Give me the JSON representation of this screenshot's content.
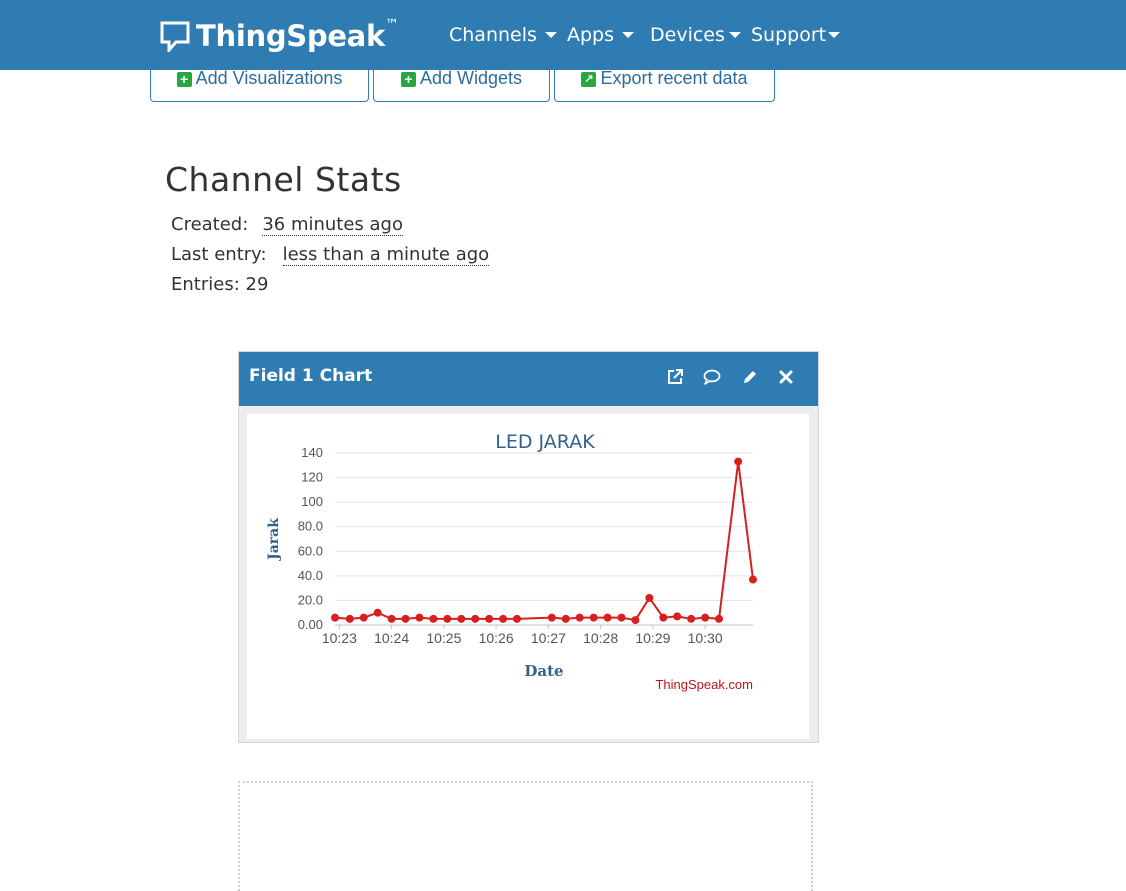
{
  "nav": {
    "brand": "ThingSpeak",
    "brand_mark": "™",
    "items": [
      {
        "label": "Channels"
      },
      {
        "label": "Apps"
      },
      {
        "label": "Devices"
      },
      {
        "label": "Support"
      }
    ]
  },
  "actions": {
    "add_visualizations": "Add Visualizations",
    "add_widgets": "Add Widgets",
    "export_recent": "Export recent data"
  },
  "stats": {
    "title": "Channel Stats",
    "created_label": "Created:",
    "created_value": "36 minutes ago",
    "last_entry_label": "Last entry:",
    "last_entry_value": "less than a minute ago",
    "entries_label": "Entries:",
    "entries_value": "29"
  },
  "widget": {
    "title": "Field 1 Chart",
    "icons": [
      "external-link-icon",
      "comment-icon",
      "pencil-icon",
      "close-icon"
    ],
    "credit": "ThingSpeak.com"
  },
  "colors": {
    "brand_blue": "#2f7cb3",
    "series_red": "#d62020",
    "axis_label_blue": "#34618a"
  },
  "chart_data": {
    "type": "line",
    "title": "LED JARAK",
    "xlabel": "Date",
    "ylabel": "Jarak",
    "ylim": [
      0,
      140
    ],
    "yticks": [
      "0.00",
      "20.0",
      "40.0",
      "60.0",
      "80.0",
      "100",
      "120",
      "140"
    ],
    "xticks": [
      "10:23",
      "10:24",
      "10:25",
      "10:26",
      "10:27",
      "10:28",
      "10:29",
      "10:30"
    ],
    "xlim": [
      "10:22:55",
      "10:30:55"
    ],
    "series": [
      {
        "color": "#d62020",
        "points": [
          [
            "10:22:55",
            6
          ],
          [
            "10:23:12",
            5
          ],
          [
            "10:23:28",
            6
          ],
          [
            "10:23:44",
            10
          ],
          [
            "10:24:00",
            5
          ],
          [
            "10:24:16",
            5
          ],
          [
            "10:24:32",
            6
          ],
          [
            "10:24:48",
            5
          ],
          [
            "10:25:04",
            5
          ],
          [
            "10:25:20",
            5
          ],
          [
            "10:25:36",
            5
          ],
          [
            "10:25:52",
            5
          ],
          [
            "10:26:08",
            5
          ],
          [
            "10:26:24",
            5
          ],
          [
            "10:27:04",
            6
          ],
          [
            "10:27:20",
            5
          ],
          [
            "10:27:36",
            6
          ],
          [
            "10:27:52",
            6
          ],
          [
            "10:28:08",
            6
          ],
          [
            "10:28:24",
            6
          ],
          [
            "10:28:40",
            4
          ],
          [
            "10:28:56",
            22
          ],
          [
            "10:29:12",
            6
          ],
          [
            "10:29:28",
            7
          ],
          [
            "10:29:44",
            5
          ],
          [
            "10:30:00",
            6
          ],
          [
            "10:30:16",
            5
          ],
          [
            "10:30:38",
            133
          ],
          [
            "10:30:55",
            37
          ]
        ]
      }
    ]
  }
}
